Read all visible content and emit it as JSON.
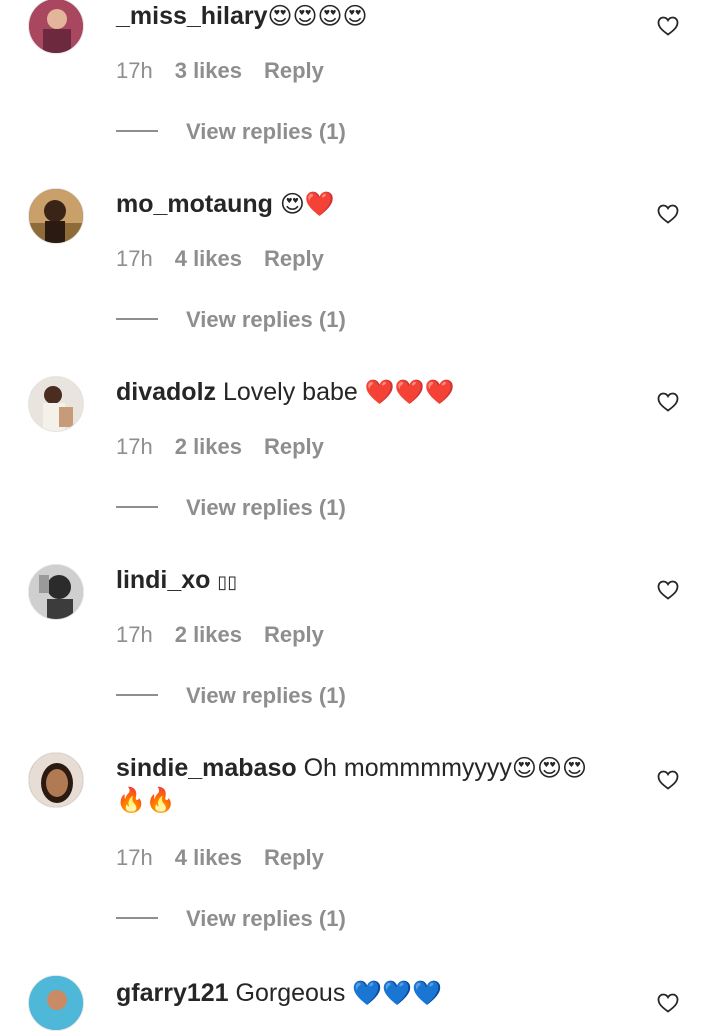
{
  "comments": [
    {
      "username": "_miss_hilary",
      "text": "",
      "emoji": "😍😍😍😍",
      "emoji2": "",
      "time": "17h",
      "likes": "3 likes",
      "reply": "Reply",
      "view_replies": "View replies (1)",
      "avatar_color": "#c0607a"
    },
    {
      "username": "mo_motaung",
      "text": "",
      "emoji": "😍❤️",
      "emoji2": "",
      "time": "17h",
      "likes": "4 likes",
      "reply": "Reply",
      "view_replies": "View replies (1)",
      "avatar_color": "#5a4030"
    },
    {
      "username": "divadolz",
      "text": " Lovely babe ",
      "emoji": "❤️❤️❤️",
      "emoji2": "",
      "time": "17h",
      "likes": "2 likes",
      "reply": "Reply",
      "view_replies": "View replies (1)",
      "avatar_color": "#d9cfc6"
    },
    {
      "username": "lindi_xo",
      "text": " ",
      "emoji": "▯▯",
      "emoji2": "",
      "time": "17h",
      "likes": "2 likes",
      "reply": "Reply",
      "view_replies": "View replies (1)",
      "avatar_color": "#b5b5b5"
    },
    {
      "username": "sindie_mabaso",
      "text": " Oh mommmmyyyy",
      "emoji": "😍😍😍",
      "emoji2": "🔥🔥",
      "time": "17h",
      "likes": "4 likes",
      "reply": "Reply",
      "view_replies": "View replies (1)",
      "avatar_color": "#8a5a3a"
    },
    {
      "username": "gfarry121",
      "text": " Gorgeous ",
      "emoji": "💙💙💙",
      "emoji2": "",
      "time": "",
      "likes": "",
      "reply": "",
      "view_replies": "",
      "avatar_color": "#3aa6c8"
    }
  ],
  "colors": {
    "text": "#262626",
    "secondary": "#8e8e8e",
    "background": "#ffffff"
  },
  "icons": {
    "like": "heart-outline-icon"
  }
}
